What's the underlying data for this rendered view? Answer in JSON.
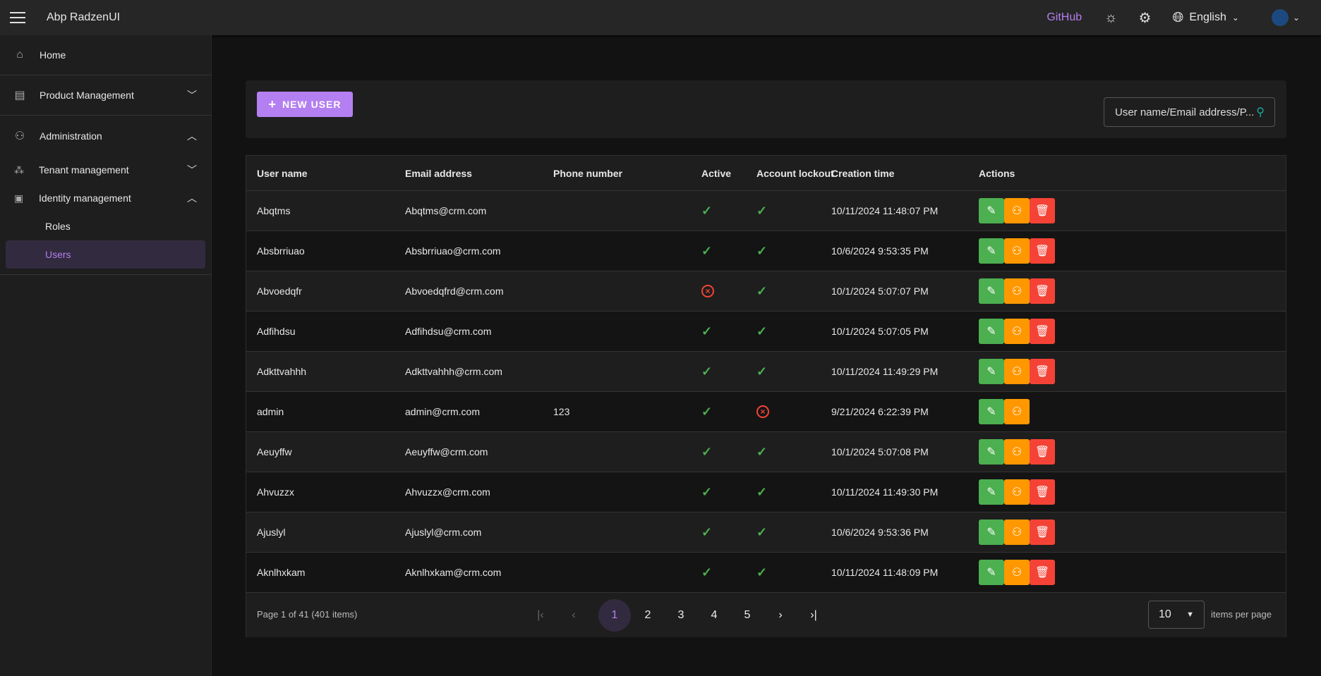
{
  "header": {
    "app_title": "Abp RadzenUI",
    "github": "GitHub",
    "language": "English"
  },
  "sidebar": {
    "home": "Home",
    "product_management": "Product Management",
    "administration": "Administration",
    "tenant_management": "Tenant management",
    "identity_management": "Identity management",
    "roles": "Roles",
    "users": "Users"
  },
  "toolbar": {
    "new_user": "NEW USER",
    "search_placeholder": "User name/Email address/P..."
  },
  "columns": [
    "User name",
    "Email address",
    "Phone number",
    "Active",
    "Account lockout",
    "Creation time",
    "Actions"
  ],
  "rows": [
    {
      "user": "Abqtms",
      "email": "Abqtms@crm.com",
      "phone": "",
      "active": true,
      "lockout": true,
      "created": "10/11/2024 11:48:07 PM",
      "deletable": true
    },
    {
      "user": "Absbrriuao",
      "email": "Absbrriuao@crm.com",
      "phone": "",
      "active": true,
      "lockout": true,
      "created": "10/6/2024 9:53:35 PM",
      "deletable": true
    },
    {
      "user": "Abvoedqfr",
      "email": "Abvoedqfrd@crm.com",
      "phone": "",
      "active": false,
      "lockout": true,
      "created": "10/1/2024 5:07:07 PM",
      "deletable": true
    },
    {
      "user": "Adfihdsu",
      "email": "Adfihdsu@crm.com",
      "phone": "",
      "active": true,
      "lockout": true,
      "created": "10/1/2024 5:07:05 PM",
      "deletable": true
    },
    {
      "user": "Adkttvahhh",
      "email": "Adkttvahhh@crm.com",
      "phone": "",
      "active": true,
      "lockout": true,
      "created": "10/11/2024 11:49:29 PM",
      "deletable": true
    },
    {
      "user": "admin",
      "email": "admin@crm.com",
      "phone": "123",
      "active": true,
      "lockout": false,
      "created": "9/21/2024 6:22:39 PM",
      "deletable": false
    },
    {
      "user": "Aeuyffw",
      "email": "Aeuyffw@crm.com",
      "phone": "",
      "active": true,
      "lockout": true,
      "created": "10/1/2024 5:07:08 PM",
      "deletable": true
    },
    {
      "user": "Ahvuzzx",
      "email": "Ahvuzzx@crm.com",
      "phone": "",
      "active": true,
      "lockout": true,
      "created": "10/11/2024 11:49:30 PM",
      "deletable": true
    },
    {
      "user": "Ajuslyl",
      "email": "Ajuslyl@crm.com",
      "phone": "",
      "active": true,
      "lockout": true,
      "created": "10/6/2024 9:53:36 PM",
      "deletable": true
    },
    {
      "user": "Aknlhxkam",
      "email": "Aknlhxkam@crm.com",
      "phone": "",
      "active": true,
      "lockout": true,
      "created": "10/11/2024 11:48:09 PM",
      "deletable": true
    }
  ],
  "pager": {
    "summary": "Page 1 of 41 (401 items)",
    "pages": [
      "1",
      "2",
      "3",
      "4",
      "5"
    ],
    "current": "1",
    "page_size": "10",
    "per_page_label": "items per page"
  },
  "colors": {
    "accent": "#b47ff0",
    "edit": "#4caf50",
    "roles": "#ff9800",
    "delete": "#f44336"
  }
}
